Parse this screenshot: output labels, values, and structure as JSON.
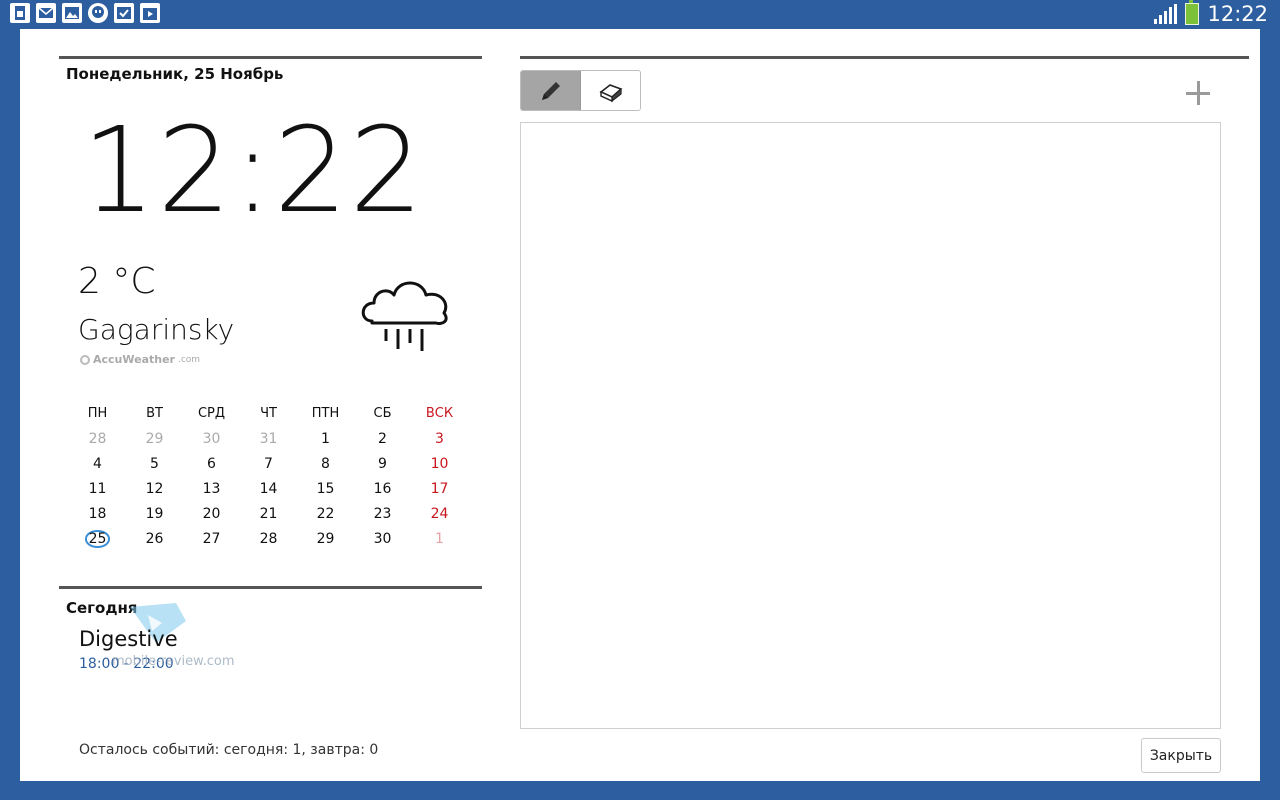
{
  "status_bar": {
    "time": "12:22",
    "notification_icons": [
      "sim-card-icon",
      "mail-icon",
      "gallery-icon",
      "hangouts-icon",
      "tasks-check-icon",
      "play-store-icon"
    ],
    "battery_color": "#7dc13b"
  },
  "header": {
    "date": "Понедельник, 25 Ноябрь"
  },
  "clock": {
    "time": "12:22"
  },
  "weather": {
    "temperature": "2 °C",
    "city": "Gagarinsky",
    "provider": "AccuWeather",
    "provider_suffix": ".com",
    "condition_icon": "rain-cloud-icon"
  },
  "calendar": {
    "weekdays": [
      "ПН",
      "ВТ",
      "СРД",
      "ЧТ",
      "ПТН",
      "СБ",
      "ВСК"
    ],
    "weeks": [
      [
        "28",
        "29",
        "30",
        "31",
        "1",
        "2",
        "3"
      ],
      [
        "4",
        "5",
        "6",
        "7",
        "8",
        "9",
        "10"
      ],
      [
        "11",
        "12",
        "13",
        "14",
        "15",
        "16",
        "17"
      ],
      [
        "18",
        "19",
        "20",
        "21",
        "22",
        "23",
        "24"
      ],
      [
        "25",
        "26",
        "27",
        "28",
        "29",
        "30",
        "1"
      ]
    ],
    "today": "25",
    "sunday_color": "#c8161e"
  },
  "today_section": {
    "title": "Сегодня",
    "events": [
      {
        "name": "Digestive",
        "time": "18:00 - 22:00"
      }
    ],
    "watermark_text": "mobile-review.com"
  },
  "footer": {
    "remaining": "Осталось событий: сегодня: 1, завтра: 0",
    "close_label": "Закрыть"
  },
  "memo": {
    "tools": [
      "pen-icon",
      "eraser-icon"
    ],
    "active_tool": "pen-icon",
    "add_icon": "plus-icon"
  },
  "colors": {
    "frame": "#2d5e9f",
    "accent": "#3a8fd6"
  }
}
